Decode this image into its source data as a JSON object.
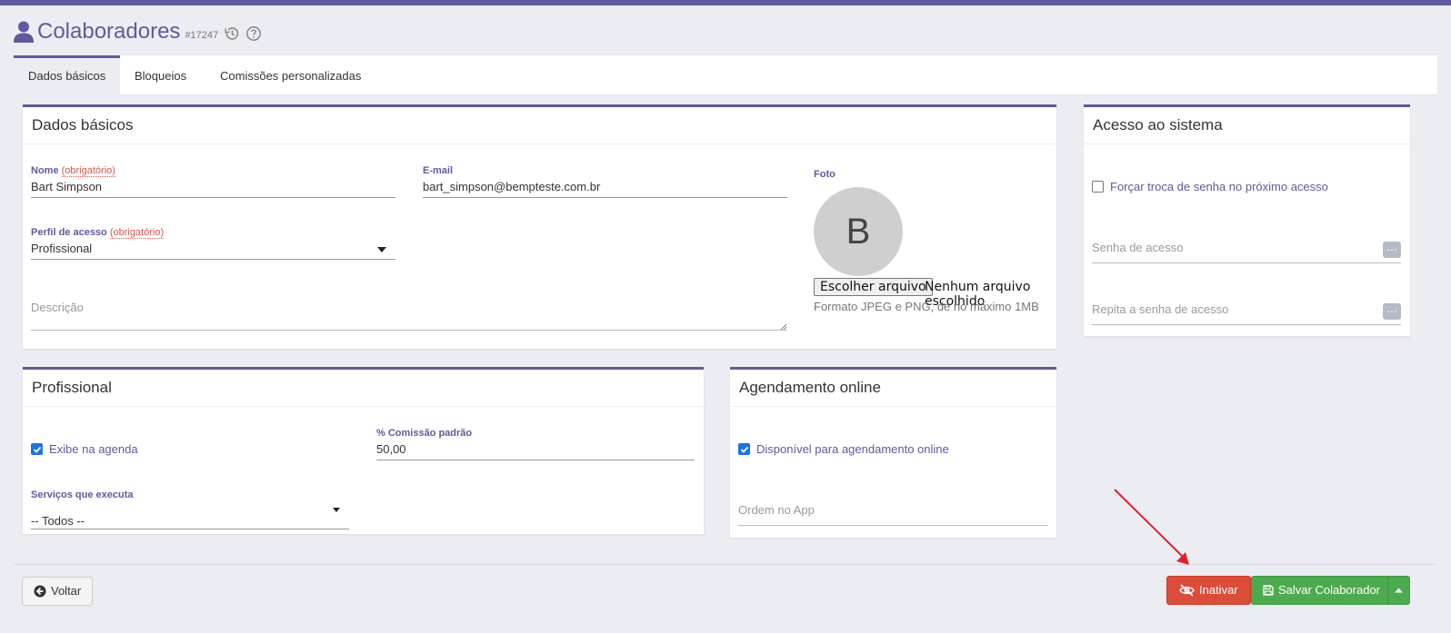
{
  "colors": {
    "accent": "#5d5aa0",
    "danger": "#dd4b39",
    "success": "#4caa4f",
    "checkbox": "#1a73e8"
  },
  "header": {
    "icon": "user-icon",
    "title": "Colaboradores",
    "record_id": "#17247",
    "history_icon": "history-icon",
    "help_icon": "help-icon"
  },
  "tabs": [
    {
      "label": "Dados básicos",
      "active": true
    },
    {
      "label": "Bloqueios",
      "active": false
    },
    {
      "label": "Comissões personalizadas",
      "active": false
    }
  ],
  "basic_data": {
    "title": "Dados básicos",
    "name": {
      "label": "Nome",
      "required": "(obrigatório)",
      "value": "Bart Simpson"
    },
    "email": {
      "label": "E-mail",
      "value": "bart_simpson@bempteste.com.br"
    },
    "profile": {
      "label": "Perfil de acesso",
      "required": "(obrigatório)",
      "value": "Profissional"
    },
    "description": {
      "placeholder": "Descrição"
    },
    "photo": {
      "label": "Foto",
      "avatar_letter": "B",
      "choose_button": "Escolher arquivo",
      "file_status": "Nenhum arquivo escolhido",
      "hint": "Formato JPEG e PNG, de no máximo 1MB"
    }
  },
  "system_access": {
    "title": "Acesso ao sistema",
    "force_password_change": {
      "label": "Forçar troca de senha no próximo acesso",
      "checked": false
    },
    "password": {
      "placeholder": "Senha de acesso"
    },
    "password_repeat": {
      "placeholder": "Repita a senha de acesso"
    }
  },
  "professional": {
    "title": "Profissional",
    "show_in_schedule": {
      "label": "Exibe na agenda",
      "checked": true
    },
    "default_commission": {
      "label": "% Comissão padrão",
      "value": "50,00"
    },
    "services": {
      "label": "Serviços que executa",
      "value": "-- Todos --"
    }
  },
  "online_booking": {
    "title": "Agendamento online",
    "available": {
      "label": "Disponível para agendamento online",
      "checked": true
    },
    "app_order": {
      "placeholder": "Ordem no App"
    }
  },
  "footer": {
    "back_label": "Voltar",
    "inactivate_label": "Inativar",
    "save_label": "Salvar Colaborador"
  }
}
